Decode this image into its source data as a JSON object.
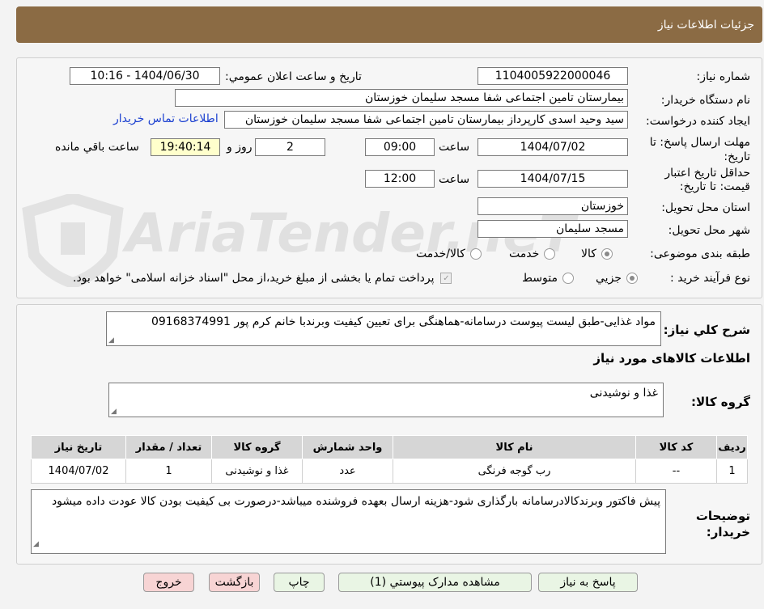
{
  "header": {
    "title": "جزئیات اطلاعات نیاز"
  },
  "need_info": {
    "need_number_label": "شماره نیاز:",
    "need_number": "1104005922000046",
    "announce_label": "تاریخ و ساعت اعلان عمومي:",
    "announce_value": "1404/06/30 - 10:16",
    "buyer_org_label": "نام دستگاه خریدار:",
    "buyer_org": "بیمارستان تامین اجتماعی شفا مسجد سلیمان خوزستان",
    "creator_label": "ایجاد کننده درخواست:",
    "creator": "سید وحید اسدی کارپرداز بیمارستان تامین اجتماعی شفا مسجد سلیمان خوزستان",
    "contact_link": "اطلاعات تماس خریدار",
    "deadline_label": "مهلت ارسال پاسخ: تا تاریخ:",
    "deadline_date": "1404/07/02",
    "time_label": "ساعت",
    "deadline_time": "09:00",
    "days_value": "2",
    "days_label": "روز و",
    "remaining_time": "19:40:14",
    "remaining_label": "ساعت باقي مانده",
    "validity_label": "حداقل تاریخ اعتبار قیمت: تا تاریخ:",
    "validity_date": "1404/07/15",
    "validity_time": "12:00",
    "province_label": "استان محل تحویل:",
    "province": "خوزستان",
    "city_label": "شهر محل تحویل:",
    "city": "مسجد سلیمان",
    "category_label": "طبقه بندی موضوعی:",
    "category_options": [
      "کالا",
      "خدمت",
      "کالا/خدمت"
    ],
    "process_label": "نوع فرآیند خرید :",
    "process_options": [
      "جزیي",
      "متوسط"
    ],
    "treasury_note": "پرداخت تمام یا بخشی از مبلغ خرید،از محل \"اسناد خزانه اسلامی\" خواهد بود."
  },
  "description": {
    "label": "شرح کلي نیاز:",
    "value": "مواد غذایی-طبق لیست پیوست درسامانه-هماهنگی برای تعیین کیفیت وبرندبا خانم کرم پور 09168374991"
  },
  "goods": {
    "section_title": "اطلاعات کالاهای مورد نیاز",
    "group_label": "گروه کالا:",
    "group_value": "غذا و نوشیدنی",
    "columns": [
      "ردیف",
      "کد کالا",
      "نام کالا",
      "واحد شمارش",
      "گروه کالا",
      "تعداد / مقدار",
      "تاریخ نیاز"
    ],
    "rows": [
      [
        "1",
        "--",
        "رب گوجه فرنگی",
        "عدد",
        "غذا و نوشیدنی",
        "1",
        "1404/07/02"
      ]
    ]
  },
  "buyer_notes": {
    "label": "توضیحات خریدار:",
    "value": "پیش فاکتور وبرندکالادرسامانه بارگذاری شود-هزینه ارسال بعهده فروشنده میباشد-درصورت بی کیفیت بودن کالا عودت داده میشود"
  },
  "buttons": {
    "reply": "پاسخ به نیاز",
    "attachments": "مشاهده مدارک پیوستي (1)",
    "print": "چاپ",
    "back": "بازگشت",
    "exit": "خروج"
  },
  "watermark": "AriaTender.neT"
}
